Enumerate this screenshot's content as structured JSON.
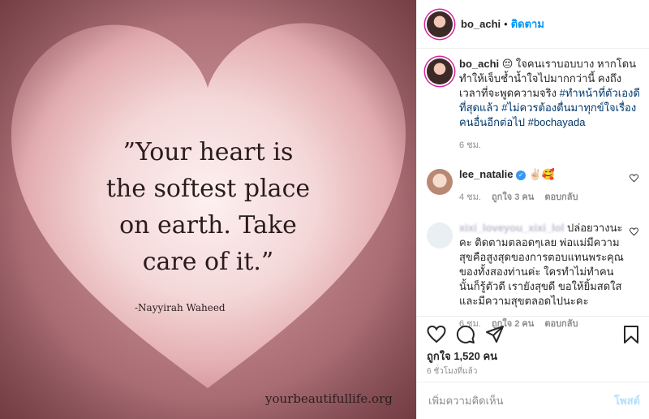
{
  "post_image": {
    "quote_lines": [
      "”Your heart is",
      "the softest place",
      "on earth. Take",
      "care of it.”"
    ],
    "author": "-Nayyirah Waheed",
    "watermark": "yourbeautifullife.org"
  },
  "header": {
    "username": "bo_achi",
    "separator": "•",
    "follow_label": "ติดตาม"
  },
  "caption": {
    "username": "bo_achi",
    "text_prefix": "😔 ใจคนเราบอบบาง หากโดนทำให้เจ็บช้ำน้ำใจไปมากกว่านี้ คงถึงเวลาที่จะพูดความจริง ",
    "tag1": "#ทำหน้าที่ตัวเองดีที่สุดแล้ว",
    "tag2": "#ไม่ควรต้องตื่นมาทุกข์ใจเรื่องคนอื่นอีกต่อไป",
    "tag3": "#bochayada",
    "time": "6 ชม."
  },
  "comments": [
    {
      "username": "lee_natalie",
      "verified": true,
      "text": "✌🏻🥰",
      "time": "4 ชม.",
      "likes": "ถูกใจ 3 คน",
      "reply": "ตอบกลับ"
    },
    {
      "username_hidden": "xixi_loveyou_xixi_lol",
      "text": "ปล่อยวางนะคะ ติดตามตลอดๆเลย พ่อแม่มีความสุขคือสูงสุดของการตอบแทนพระคุณของทั้งสองท่านค่ะ ใครทำไม่ทำคนนั้นก็รู้ตัวดี เรายังสุขดี ขอให้ยิ้มสดใสและมีความสุขตลอดไปนะคะ",
      "time": "6 ชม.",
      "likes": "ถูกใจ 2 คน",
      "reply": "ตอบกลับ"
    }
  ],
  "likes_count": "ถูกใจ 1,520 คน",
  "post_time": "6 ชั่วโมงที่แล้ว",
  "add_comment": {
    "placeholder": "เพิ่มความคิดเห็น",
    "post_label": "โพสต์"
  },
  "colors": {
    "link": "#0095f6",
    "hashtag": "#00376b",
    "muted": "#8e8e8e"
  }
}
